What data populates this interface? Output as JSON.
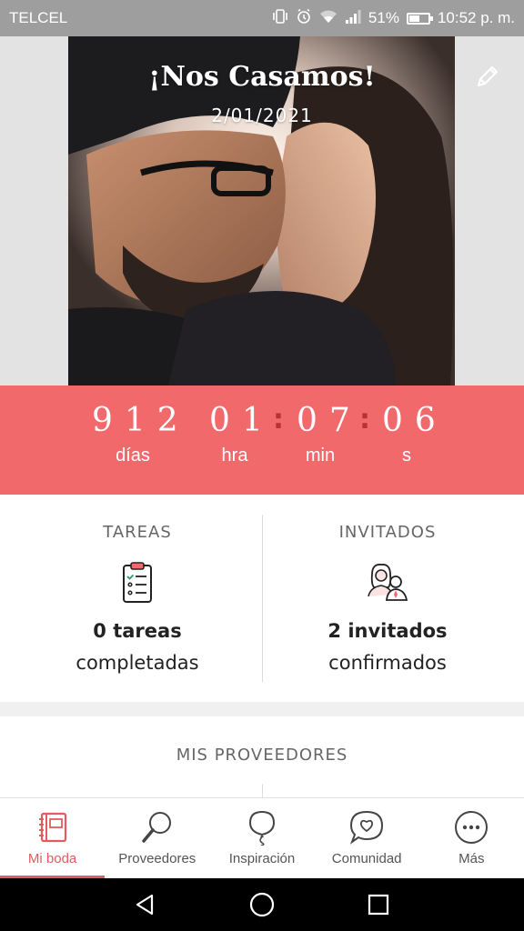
{
  "status_bar": {
    "carrier": "TELCEL",
    "battery": "51%",
    "time": "10:52 p. m.",
    "battery_level": 0.51,
    "icons": [
      "vibrate-icon",
      "alarm-icon",
      "wifi-icon",
      "signal-icon",
      "battery-icon"
    ]
  },
  "hero": {
    "title": "¡Nos Casamos!",
    "date": "2/01/2021",
    "edit_icon": "pencil-icon"
  },
  "countdown": {
    "days": "912",
    "hours": "01",
    "minutes": "07",
    "seconds": "06",
    "separator": ":",
    "labels": {
      "days": "días",
      "hours": "hra",
      "minutes": "min",
      "seconds": "s"
    }
  },
  "stats": {
    "tasks": {
      "title": "TAREAS",
      "strong": "0 tareas",
      "sub": "completadas",
      "icon": "checklist-icon"
    },
    "guests": {
      "title": "INVITADOS",
      "strong": "2 invitados",
      "sub": "confirmados",
      "icon": "guests-icon"
    }
  },
  "providers": {
    "title": "MIS PROVEEDORES"
  },
  "bottom_nav": {
    "items": [
      {
        "label": "Mi boda",
        "icon": "notebook-icon",
        "active": true
      },
      {
        "label": "Proveedores",
        "icon": "search-icon",
        "active": false
      },
      {
        "label": "Inspiración",
        "icon": "balloon-icon",
        "active": false
      },
      {
        "label": "Comunidad",
        "icon": "chat-heart-icon",
        "active": false
      },
      {
        "label": "Más",
        "icon": "more-icon",
        "active": false
      }
    ]
  },
  "colors": {
    "accent": "#f2696c",
    "accent_dark": "#e25b5e",
    "separator": "#b73235",
    "status_bar": "#9e9e9e"
  }
}
